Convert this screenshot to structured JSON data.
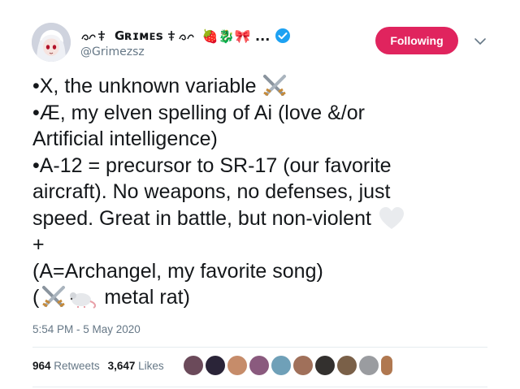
{
  "header": {
    "display_name_text": "Gʀɪᴍᴇs",
    "display_name_emojis": "🍓🐉🎀 ...",
    "handle": "@Grimezsz",
    "follow_button": "Following"
  },
  "tweet": {
    "lines": [
      "•X, the unknown variable",
      "•Æ, my elven spelling of Ai (love &/or",
      "Artificial intelligence)",
      "•A-12 = precursor to SR-17 (our favorite",
      "aircraft).  No weapons, no defenses, just",
      "speed.  Great in battle, but non-violent",
      "+",
      "(A=Archangel, my favorite song)",
      "(",
      "metal rat)"
    ],
    "timestamp": "5:54 PM - 5 May 2020"
  },
  "stats": {
    "retweets_count": "964",
    "retweets_label": "Retweets",
    "likes_count": "3,647",
    "likes_label": "Likes"
  },
  "colors": {
    "follow_button": "#e0245e",
    "verified": "#1da1f2",
    "muted_text": "#657786"
  },
  "icons": [
    "crossed-swords-icon",
    "white-heart-icon",
    "rat-icon",
    "verified-badge-icon",
    "chevron-down-icon"
  ]
}
